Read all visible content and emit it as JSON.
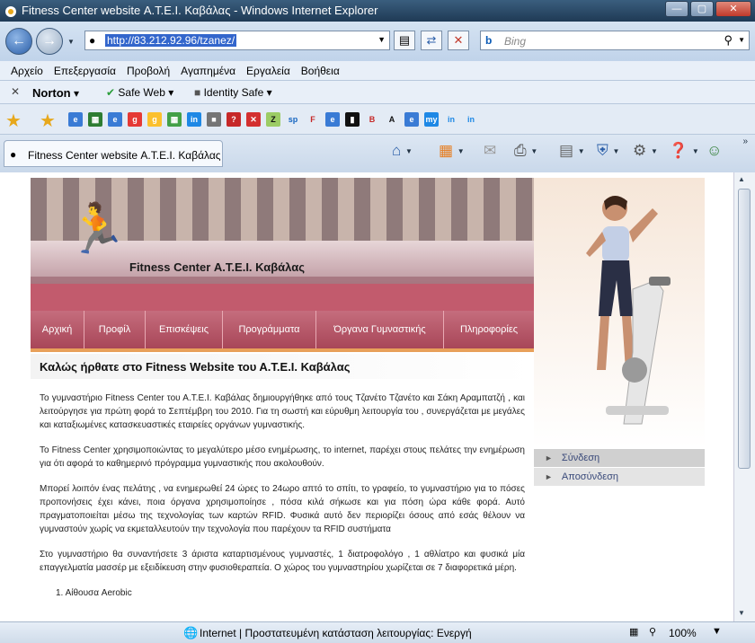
{
  "window": {
    "title": "Fitness Center website Α.Τ.Ε.Ι. Καβάλας - Windows Internet Explorer"
  },
  "address": {
    "url": "http://83.212.92.96/tzanez/"
  },
  "search": {
    "placeholder": "Bing"
  },
  "menu": [
    "Αρχείο",
    "Επεξεργασία",
    "Προβολή",
    "Αγαπημένα",
    "Εργαλεία",
    "Βοήθεια"
  ],
  "norton": {
    "brand": "Norton",
    "safe_web": "Safe Web",
    "identity_safe": "Identity Safe"
  },
  "tab": {
    "label": "Fitness Center website Α.Τ.Ε.Ι. Καβάλας"
  },
  "site": {
    "title": "Fitness Center Α.Τ.Ε.Ι. Καβάλας",
    "nav": [
      "Αρχική",
      "Προφίλ",
      "Επισκέψεις",
      "Προγράμματα",
      "Όργανα Γυμναστικής",
      "Πληροφορίες"
    ],
    "welcome": "Καλώς ήρθατε στο Fitness Website του Α.Τ.Ε.Ι. Καβάλας",
    "paragraphs": [
      "Το γυμναστήριο Fitness Center του Α.Τ.Ε.Ι. Καβάλας δημιουργήθηκε από τους Τζανέτο Τζανέτο και Σάκη Αραμπατζή , και λειτούργησε για πρώτη φορά το Σεπτέμβρη του 2010.  Για τη σωστή και εύρυθμη λειτουργία του , συνεργάζεται με μεγάλες και καταξιωμένες κατασκευαστικές εταιρείες οργάνων γυμναστικής.",
      "Το Fitness Center χρησιμοποιώντας το μεγαλύτερο μέσο ενημέρωσης, το internet,  παρέχει στους πελάτες την ενημέρωση για ότι αφορά το καθημερινό πρόγραμμα γυμναστικής που ακολουθούν.",
      "Μπορεί λοιπόν ένας πελάτης , να ενημερωθεί 24 ώρες το 24ωρο απτό το σπίτι, το γραφείο, το γυμναστήριο για το πόσες προπονήσεις έχει κάνει, ποια όργανα χρησιμοποίησε , πόσα κιλά σήκωσε και για πόση ώρα κάθε φορά. Αυτό πραγματοποιείται μέσω της τεχνολογίας των καρτών RFID. Φυσικά αυτό δεν περιορίζει όσους από εσάς θέλουν να γυμναστούν χωρίς να εκμεταλλευτούν την τεχνολογία που παρέχουν τα RFID συστήματα",
      "Στο γυμναστήριο θα συναντήσετε 3 άριστα καταρτισμένους γυμναστές, 1 διατροφολόγο , 1 αθλίατρο και φυσικά μία επαγγελματία μασσέρ με εξειδίκευση στην φυσιοθεραπεία. Ο χώρος του γυμναστηρίου χωρίζεται σε 7 διαφορετικά μέρη."
    ],
    "list_item": "1.     Αίθουσα Aerobic",
    "side_menu": [
      "Σύνδεση",
      "Αποσύνδεση"
    ]
  },
  "status": {
    "text": "Internet | Προστατευμένη κατάσταση λειτουργίας: Ενεργή",
    "zoom": "100%"
  }
}
